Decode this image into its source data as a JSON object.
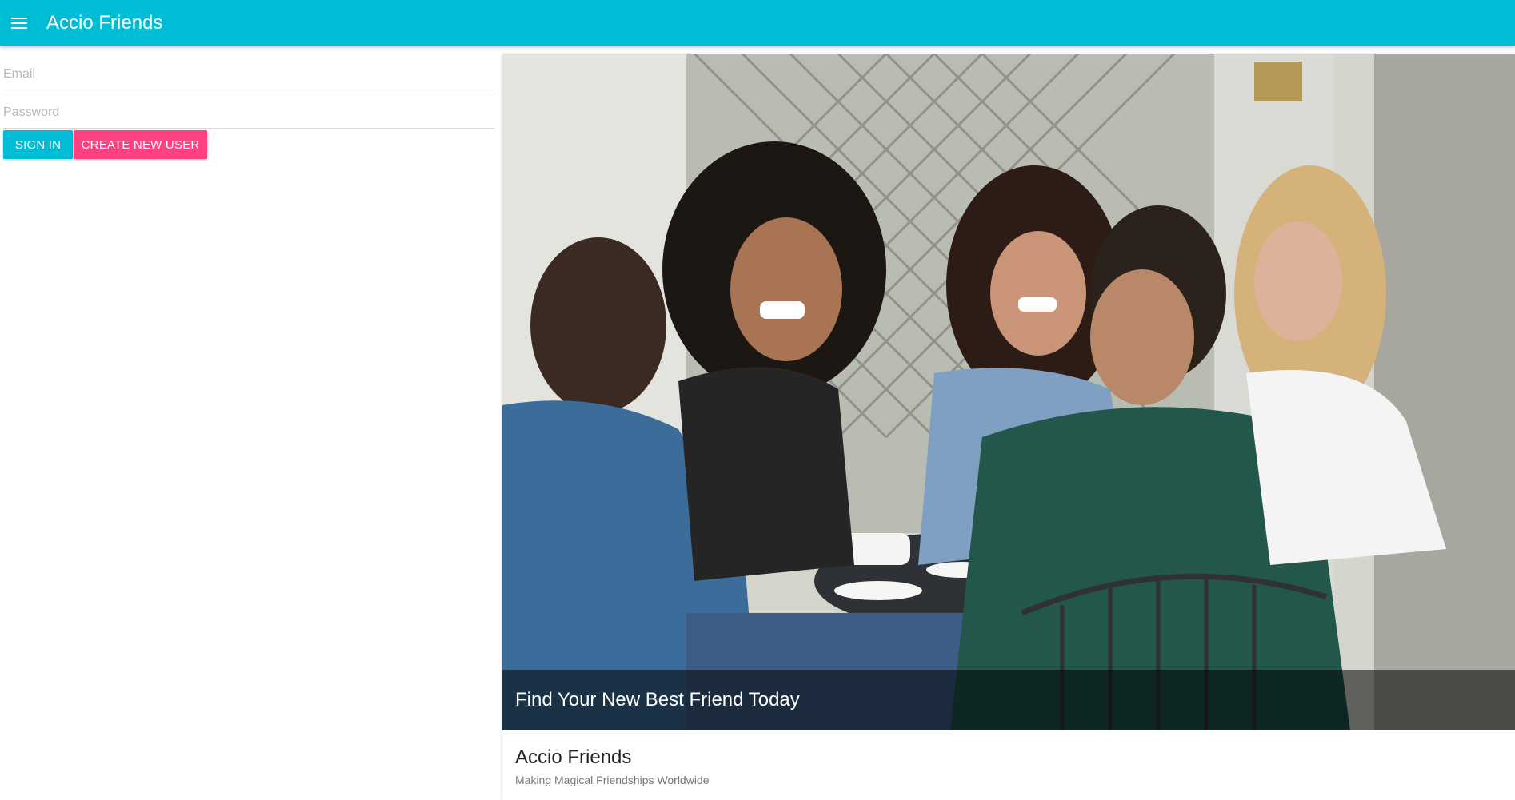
{
  "appbar": {
    "title": "Accio Friends",
    "menu_icon": "hamburger-menu-icon",
    "color": "#00bcd4"
  },
  "login": {
    "email_placeholder": "Email",
    "email_value": "",
    "password_placeholder": "Password",
    "password_value": "",
    "signin_label": "SIGN IN",
    "create_label": "CREATE NEW USER",
    "signin_color": "#00bcd4",
    "create_color": "#ff4081"
  },
  "card": {
    "caption": "Find Your New Best Friend Today",
    "title": "Accio Friends",
    "subtitle": "Making Magical Friendships Worldwide",
    "image_subject": "group-of-friends-laughing-at-cafe-table"
  }
}
